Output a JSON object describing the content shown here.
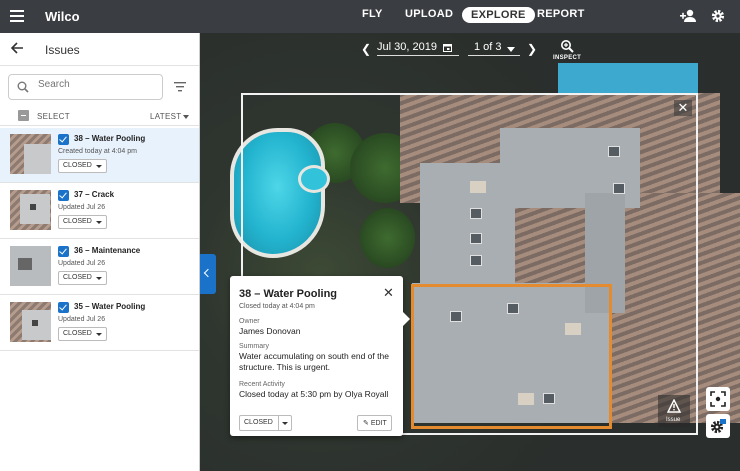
{
  "app": {
    "brand": "Wilco"
  },
  "nav": {
    "fly": "FLY",
    "upload": "UPLOAD",
    "explore": "EXPLORE",
    "report": "REPORT"
  },
  "sidebar": {
    "title": "Issues",
    "search_placeholder": "Search",
    "select_label": "SELECT",
    "sort_label": "LATEST",
    "issues": [
      {
        "title": "38 – Water Pooling",
        "sub": "Created today at 4:04 pm",
        "status": "CLOSED"
      },
      {
        "title": "37 – Crack",
        "sub": "Updated Jul 26",
        "status": "CLOSED"
      },
      {
        "title": "36 – Maintenance",
        "sub": "Updated Jul 26",
        "status": "CLOSED"
      },
      {
        "title": "35 – Water Pooling",
        "sub": "Updated Jul 26",
        "status": "CLOSED"
      }
    ]
  },
  "viewer": {
    "date": "Jul 30, 2019",
    "count": "1 of 3",
    "inspect_label": "INSPECT",
    "close_glyph": "✕",
    "issue_tool_label": "Issue"
  },
  "popup": {
    "title": "38 – Water Pooling",
    "sub": "Closed today at 4:04 pm",
    "owner_label": "Owner",
    "owner": "James Donovan",
    "summary_label": "Summary",
    "summary": "Water accumulating on south end of the structure. This is urgent.",
    "activity_label": "Recent Activity",
    "activity": "Closed today at 5:30 pm by Olya Royall",
    "status": "CLOSED",
    "edit_label": "EDIT"
  },
  "colors": {
    "accent": "#1a73c9",
    "annotation": "#e58b2f",
    "topbar": "#3a3d41"
  }
}
